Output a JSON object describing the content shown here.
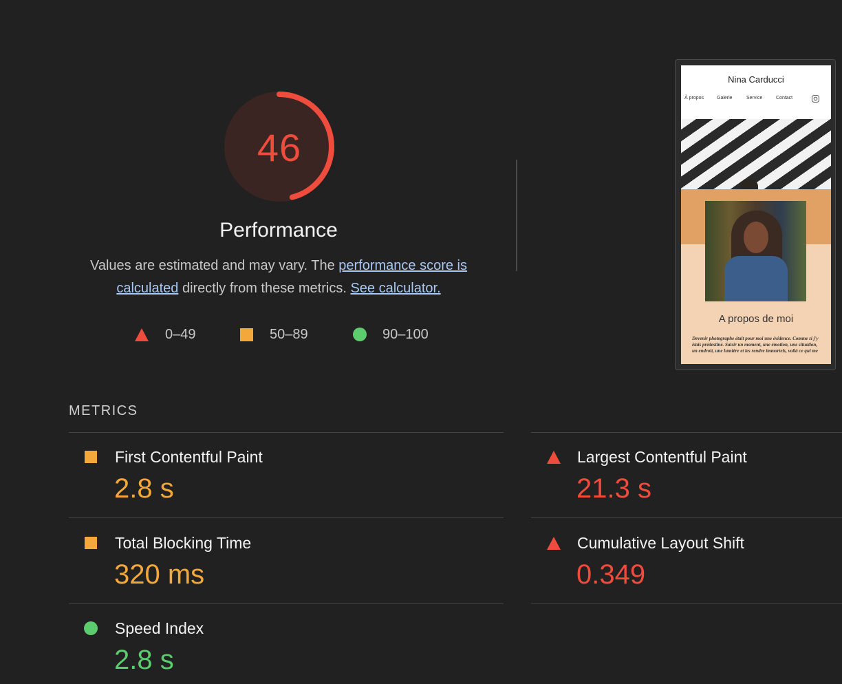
{
  "score": {
    "value": 46,
    "fraction": 0.46,
    "category": "Performance",
    "desc_prefix": "Values are estimated and may vary. The ",
    "desc_link": "performance score is calculated",
    "desc_middle": " directly from these metrics. ",
    "desc_link2": "See calculator.",
    "color": "#ee4c3c"
  },
  "legend": [
    {
      "icon": "triangle-icon",
      "label": "0–49",
      "color": "#ee4c3c"
    },
    {
      "icon": "square-icon",
      "label": "50–89",
      "color": "#f4a83b"
    },
    {
      "icon": "circle-icon",
      "label": "90–100",
      "color": "#5ccc6e"
    }
  ],
  "thumbnail": {
    "site_name": "Nina Carducci",
    "nav": [
      "À propos",
      "Galerie",
      "Service",
      "Contact"
    ],
    "about_title": "A propos de moi",
    "bio": "Devenir photographe était pour moi une évidence. Comme si j'y étais prédestiné. Saisir un moment, une émotion, une situation, un endroit, une lumière et les rendre immortels, voilà ce qui me"
  },
  "metrics": {
    "label": "METRICS",
    "items": [
      {
        "name": "First Contentful Paint",
        "value": "2.8 s",
        "status": "average"
      },
      {
        "name": "Largest Contentful Paint",
        "value": "21.3 s",
        "status": "fail"
      },
      {
        "name": "Total Blocking Time",
        "value": "320 ms",
        "status": "average"
      },
      {
        "name": "Cumulative Layout Shift",
        "value": "0.349",
        "status": "fail"
      },
      {
        "name": "Speed Index",
        "value": "2.8 s",
        "status": "pass"
      }
    ]
  },
  "colors": {
    "fail": "#ee4c3c",
    "average": "#f4a83b",
    "pass": "#5ccc6e",
    "background": "#212121"
  }
}
